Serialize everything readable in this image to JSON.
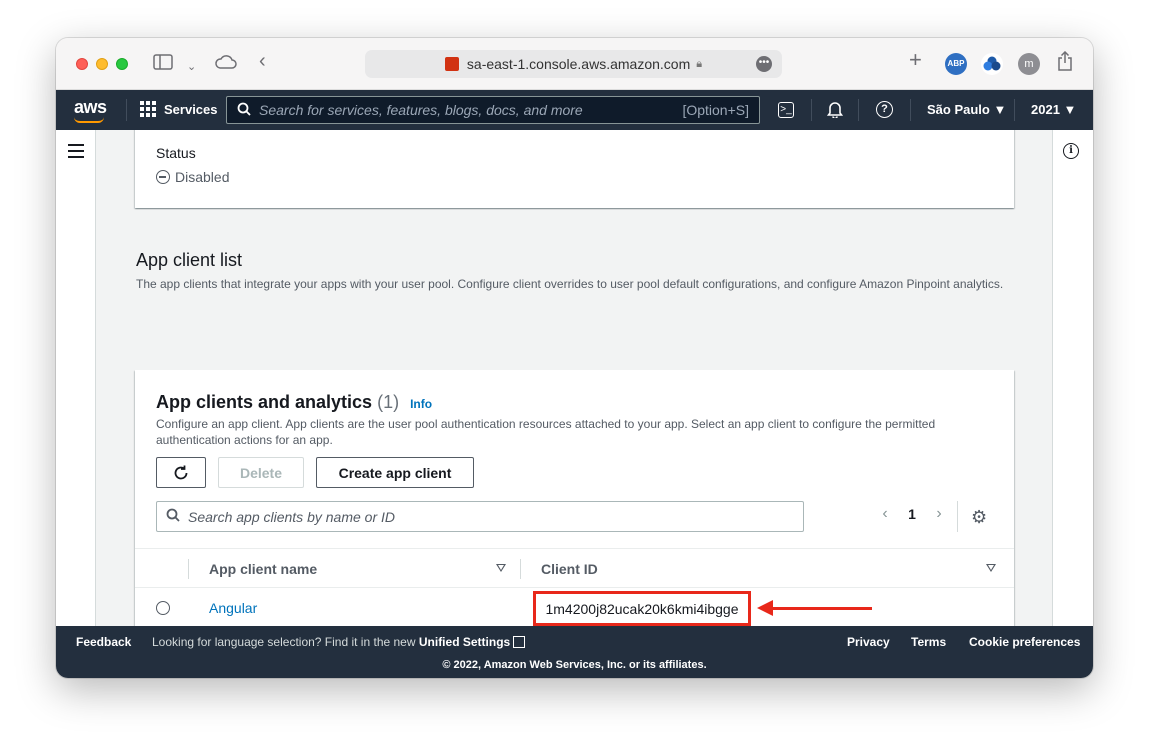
{
  "browser": {
    "url": "sa-east-1.console.aws.amazon.com",
    "extensions": [
      "ABP"
    ]
  },
  "aws_nav": {
    "logo": "aws",
    "services_label": "Services",
    "search_placeholder": "Search for services, features, blogs, docs, and more",
    "search_shortcut": "[Option+S]",
    "region": "São Paulo",
    "account": "2021"
  },
  "status_section": {
    "label": "Status",
    "value": "Disabled"
  },
  "app_client_list": {
    "title": "App client list",
    "description": "The app clients that integrate your apps with your user pool. Configure client overrides to user pool default configurations, and configure Amazon Pinpoint analytics."
  },
  "clients_card": {
    "title": "App clients and analytics",
    "count": "(1)",
    "info_label": "Info",
    "description": "Configure an app client. App clients are the user pool authentication resources attached to your app. Select an app client to configure the permitted authentication actions for an app.",
    "refresh_icon": "refresh-icon",
    "delete_label": "Delete",
    "create_label": "Create app client",
    "search_placeholder": "Search app clients by name or ID",
    "page": "1",
    "columns": [
      "App client name",
      "Client ID"
    ],
    "rows": [
      {
        "name": "Angular",
        "client_id": "1m4200j82ucak20k6kmi4ibgge"
      }
    ]
  },
  "footer": {
    "feedback": "Feedback",
    "lang_text": "Looking for language selection? Find it in the new",
    "unified_settings": "Unified Settings",
    "privacy": "Privacy",
    "terms": "Terms",
    "cookies": "Cookie preferences",
    "copyright": "© 2022, Amazon Web Services, Inc. or its affiliates."
  },
  "colors": {
    "nav_bg": "#232f3e",
    "link": "#0073bb",
    "annotation": "#e8281a",
    "aws_orange": "#ff9900"
  }
}
